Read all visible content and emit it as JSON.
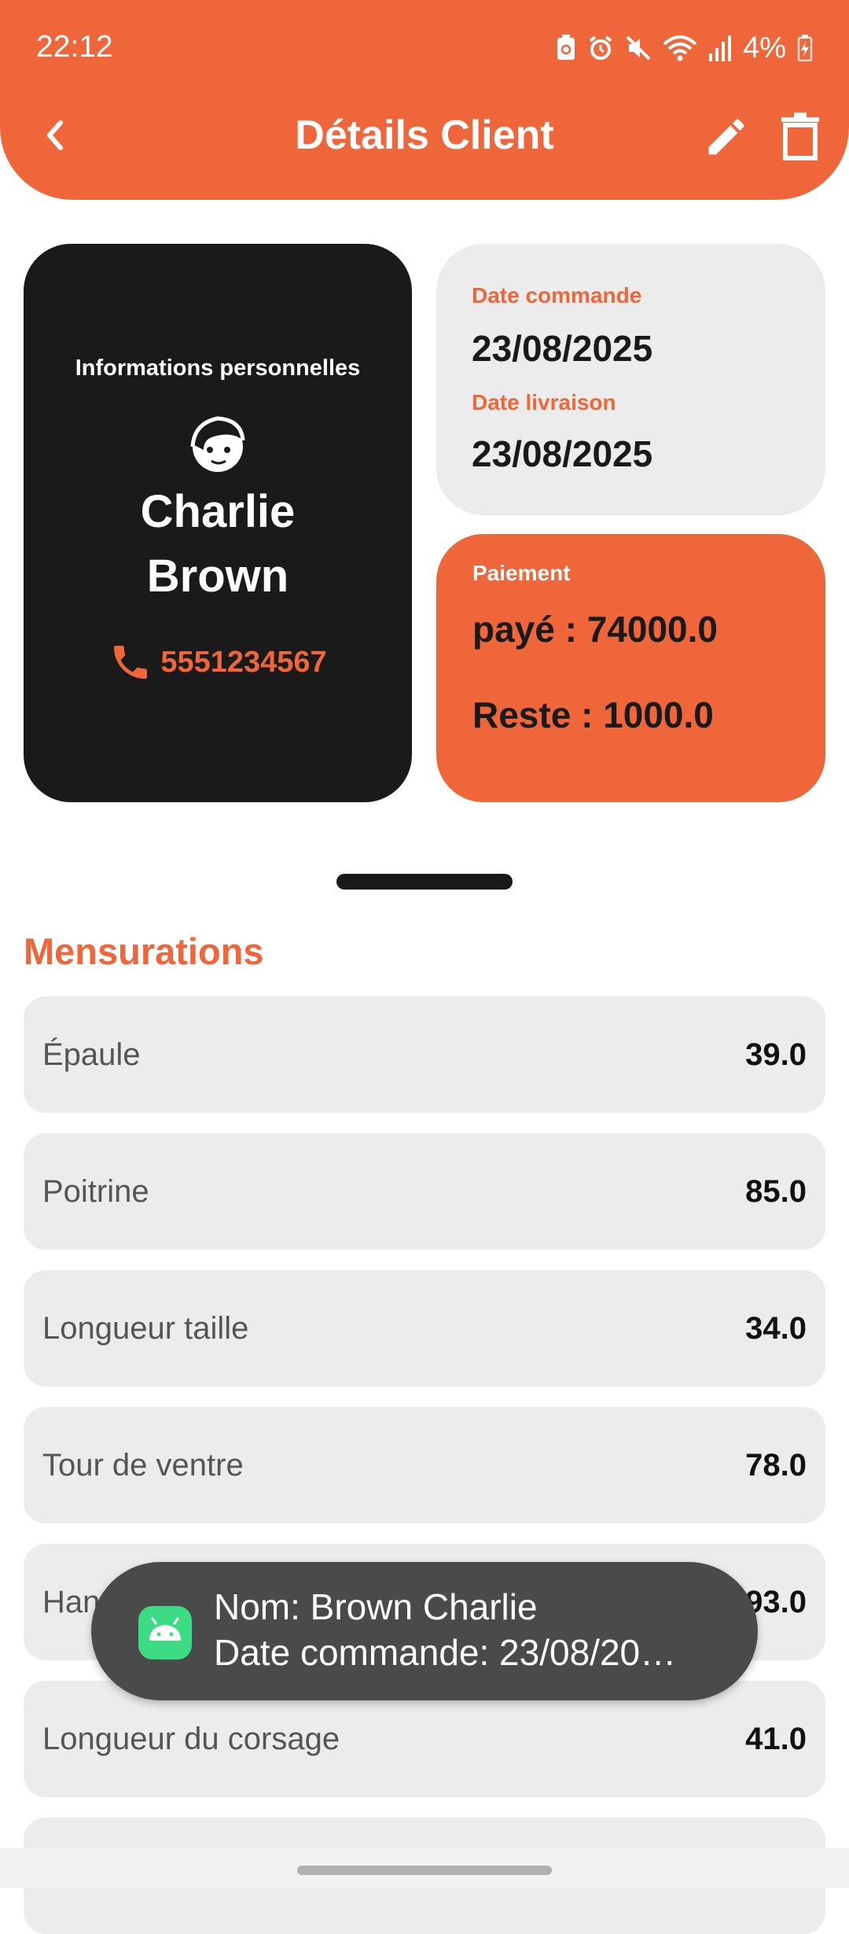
{
  "status_bar": {
    "time": "22:12",
    "battery": "4%"
  },
  "header": {
    "title": "Détails Client"
  },
  "personal": {
    "heading": "Informations personnelles",
    "first_name": "Charlie",
    "last_name": "Brown",
    "phone": "5551234567"
  },
  "dates": {
    "order_label": "Date commande",
    "order_value": "23/08/2025",
    "delivery_label": "Date livraison",
    "delivery_value": "23/08/2025"
  },
  "payment": {
    "label": "Paiement",
    "paid": "payé : 74000.0",
    "remaining": "Reste : 1000.0"
  },
  "measurements": {
    "title": "Mensurations",
    "items": [
      {
        "label": "Épaule",
        "value": "39.0"
      },
      {
        "label": "Poitrine",
        "value": "85.0"
      },
      {
        "label": "Longueur taille",
        "value": "34.0"
      },
      {
        "label": "Tour de ventre",
        "value": "78.0"
      },
      {
        "label": "Hanche",
        "value": "93.0"
      },
      {
        "label": "Longueur du corsage",
        "value": "41.0"
      }
    ]
  },
  "toast": {
    "line1": "Nom: Brown Charlie",
    "line2": "Date commande: 23/08/20…"
  },
  "colors": {
    "accent": "#EE663A",
    "dark": "#1B1A1A",
    "row_bg": "#ECECEC"
  }
}
